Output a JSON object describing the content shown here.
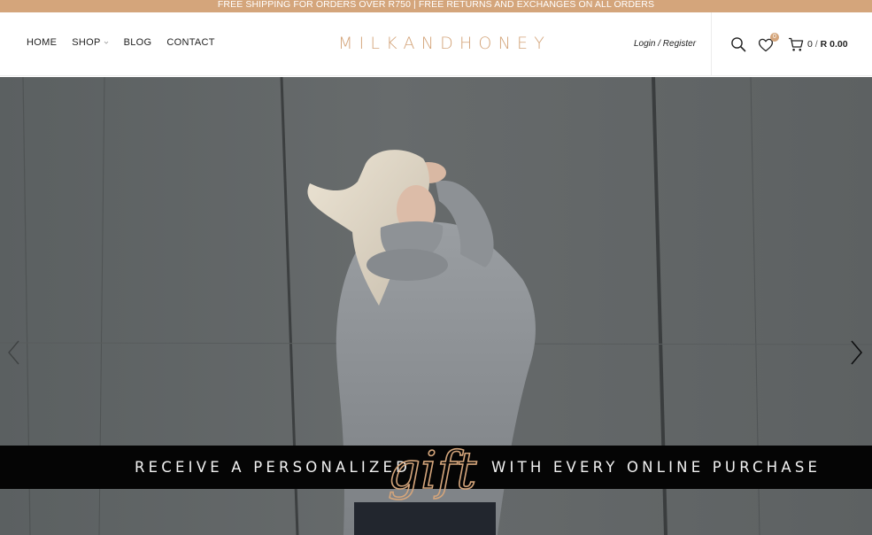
{
  "announcement": "FREE SHIPPING FOR ORDERS OVER R750 | FREE RETURNS AND EXCHANGES ON ALL ORDERS",
  "nav": {
    "home": "HOME",
    "shop": "SHOP",
    "blog": "BLOG",
    "contact": "CONTACT"
  },
  "logo": "MILKANDHONEY",
  "account": {
    "login_label": "Login / Register"
  },
  "icons": {
    "search": "search-icon",
    "wishlist": "heart-icon",
    "cart": "cart-icon",
    "prev": "chevron-left-icon",
    "next": "chevron-right-icon"
  },
  "wishlist": {
    "count": "0"
  },
  "cart": {
    "count": "0",
    "separator": "/",
    "total": "R 0.00"
  },
  "hero": {
    "promo_left": "RECEIVE A PERSONALIZED",
    "promo_script": "gift",
    "promo_right": "WITH EVERY ONLINE PURCHASE"
  },
  "colors": {
    "accent": "#d4a57b",
    "band": "#050505",
    "wall": "#5f6364"
  }
}
